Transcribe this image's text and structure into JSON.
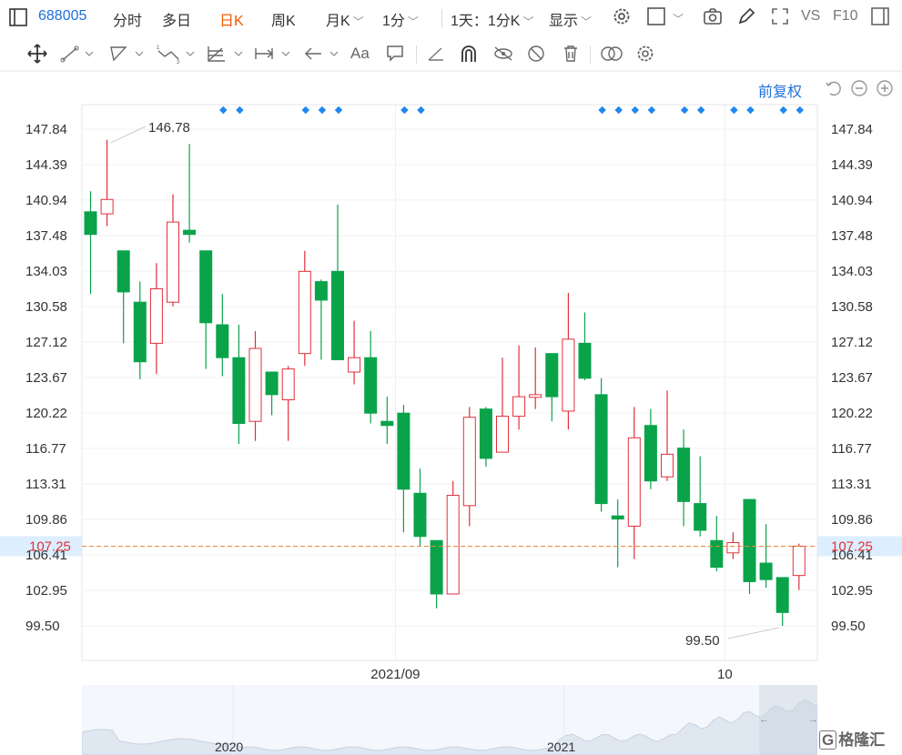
{
  "topbar": {
    "code": "688005",
    "tabs": [
      "分时",
      "多日",
      "日K",
      "周K"
    ],
    "active_tab": "日K",
    "month_k": "月K",
    "one_min": "1分",
    "combo": "1天：1分K",
    "display": "显示",
    "vs": "VS",
    "f10": "F10"
  },
  "adjust_label": "前复权",
  "colors": {
    "up": "#e0303a",
    "down": "#0aa34a",
    "accent": "#1e6fd9",
    "active": "#f05a00",
    "price_line": "#e8883a"
  },
  "icons": {
    "move": "move-icon",
    "line": "line-draw-icon",
    "channel": "channel-icon",
    "wave": "wave-icon",
    "fib": "fib-icon",
    "measure": "measure-icon",
    "arrow": "arrow-icon",
    "text": "text-icon",
    "comment": "comment-icon",
    "ruler": "ruler-icon",
    "magnet": "magnet-icon",
    "lock": "lock-icon",
    "hide": "hide-icon",
    "trash": "trash-icon",
    "overlap": "overlap-icon",
    "settings": "gear-icon"
  },
  "navigator": {
    "labels": [
      "2020",
      "2021"
    ]
  },
  "watermark": "格隆汇",
  "chart_data": {
    "type": "candlestick",
    "y_ticks": [
      "147.84",
      "144.39",
      "140.94",
      "137.48",
      "134.03",
      "130.58",
      "127.12",
      "123.67",
      "120.22",
      "116.77",
      "113.31",
      "109.86",
      "106.41",
      "102.95",
      "99.50"
    ],
    "ylim": [
      96.04,
      151.3
    ],
    "x_labels": [
      {
        "label": "2021/09",
        "index": 19
      },
      {
        "label": "10",
        "index": 39
      }
    ],
    "current_price": "107.25",
    "max_label": "146.78",
    "min_label": "99.50",
    "dot_groups": [
      [
        8,
        9
      ],
      [
        13,
        14,
        15
      ],
      [
        19,
        20
      ],
      [
        31,
        32,
        33,
        34
      ],
      [
        36,
        37
      ],
      [
        39,
        40
      ],
      [
        42,
        43
      ]
    ],
    "candles": [
      {
        "o": 139.8,
        "h": 141.8,
        "l": 131.8,
        "c": 137.6
      },
      {
        "o": 139.6,
        "h": 146.8,
        "l": 138.4,
        "c": 141.0
      },
      {
        "o": 136.0,
        "h": 136.0,
        "l": 127.0,
        "c": 132.0
      },
      {
        "o": 131.0,
        "h": 133.0,
        "l": 123.5,
        "c": 125.2
      },
      {
        "o": 127.0,
        "h": 134.8,
        "l": 124.0,
        "c": 132.3
      },
      {
        "o": 131.0,
        "h": 141.5,
        "l": 130.6,
        "c": 138.8
      },
      {
        "o": 138.0,
        "h": 146.4,
        "l": 136.8,
        "c": 137.6
      },
      {
        "o": 136.0,
        "h": 136.0,
        "l": 124.5,
        "c": 129.0
      },
      {
        "o": 128.8,
        "h": 131.8,
        "l": 123.8,
        "c": 125.6
      },
      {
        "o": 125.6,
        "h": 128.8,
        "l": 117.2,
        "c": 119.2
      },
      {
        "o": 119.4,
        "h": 128.2,
        "l": 117.5,
        "c": 126.5
      },
      {
        "o": 124.2,
        "h": 124.2,
        "l": 120.0,
        "c": 122.0
      },
      {
        "o": 121.5,
        "h": 124.8,
        "l": 117.5,
        "c": 124.5
      },
      {
        "o": 126.0,
        "h": 136.0,
        "l": 124.8,
        "c": 134.0
      },
      {
        "o": 133.0,
        "h": 133.2,
        "l": 125.4,
        "c": 131.2
      },
      {
        "o": 134.0,
        "h": 140.5,
        "l": 125.4,
        "c": 125.4
      },
      {
        "o": 124.2,
        "h": 129.2,
        "l": 123.0,
        "c": 125.6
      },
      {
        "o": 125.6,
        "h": 128.2,
        "l": 119.2,
        "c": 120.2
      },
      {
        "o": 119.4,
        "h": 121.8,
        "l": 117.2,
        "c": 119.0
      },
      {
        "o": 120.2,
        "h": 121.0,
        "l": 108.6,
        "c": 112.8
      },
      {
        "o": 112.4,
        "h": 114.8,
        "l": 107.2,
        "c": 108.2
      },
      {
        "o": 107.8,
        "h": 107.8,
        "l": 101.2,
        "c": 102.6
      },
      {
        "o": 102.6,
        "h": 113.6,
        "l": 102.6,
        "c": 112.2
      },
      {
        "o": 111.2,
        "h": 120.8,
        "l": 109.2,
        "c": 119.8
      },
      {
        "o": 120.6,
        "h": 120.8,
        "l": 115.0,
        "c": 115.8
      },
      {
        "o": 116.4,
        "h": 125.6,
        "l": 116.4,
        "c": 119.9
      },
      {
        "o": 119.9,
        "h": 126.8,
        "l": 118.6,
        "c": 121.8
      },
      {
        "o": 122.0,
        "h": 126.6,
        "l": 120.6,
        "c": 122.0
      },
      {
        "o": 126.0,
        "h": 126.0,
        "l": 119.4,
        "c": 121.8
      },
      {
        "o": 120.4,
        "h": 131.9,
        "l": 118.6,
        "c": 127.4
      },
      {
        "o": 127.0,
        "h": 130.0,
        "l": 123.4,
        "c": 123.6
      },
      {
        "o": 122.0,
        "h": 123.6,
        "l": 110.6,
        "c": 111.4
      },
      {
        "o": 110.2,
        "h": 111.8,
        "l": 105.2,
        "c": 109.9
      },
      {
        "o": 109.2,
        "h": 120.8,
        "l": 106.0,
        "c": 117.8
      },
      {
        "o": 119.0,
        "h": 120.6,
        "l": 112.8,
        "c": 113.6
      },
      {
        "o": 114.0,
        "h": 122.4,
        "l": 113.6,
        "c": 116.2
      },
      {
        "o": 116.8,
        "h": 118.6,
        "l": 109.2,
        "c": 111.6
      },
      {
        "o": 111.4,
        "h": 116.0,
        "l": 108.2,
        "c": 108.8
      },
      {
        "o": 107.8,
        "h": 110.2,
        "l": 104.8,
        "c": 105.2
      },
      {
        "o": 106.6,
        "h": 108.6,
        "l": 106.0,
        "c": 107.6
      },
      {
        "o": 111.8,
        "h": 111.8,
        "l": 102.6,
        "c": 103.8
      },
      {
        "o": 105.6,
        "h": 109.4,
        "l": 103.2,
        "c": 104.0
      },
      {
        "o": 104.2,
        "h": 104.2,
        "l": 99.5,
        "c": 100.8
      },
      {
        "o": 104.4,
        "h": 107.5,
        "l": 103.0,
        "c": 107.25
      }
    ]
  }
}
